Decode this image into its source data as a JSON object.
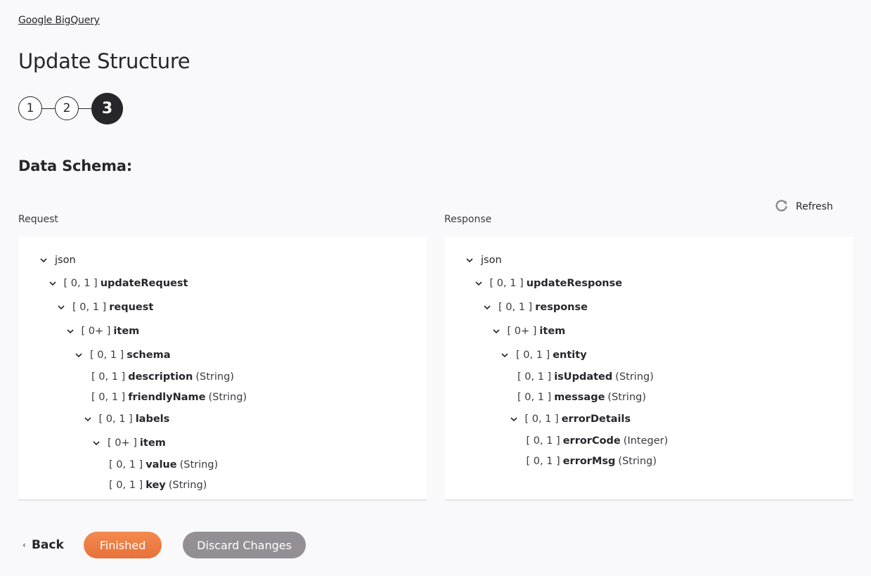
{
  "breadcrumb": "Google BigQuery",
  "title": "Update Structure",
  "stepper": {
    "steps": [
      "1",
      "2",
      "3"
    ],
    "active_step": 3
  },
  "section_title": "Data Schema:",
  "refresh_label": "Refresh",
  "request": {
    "label": "Request",
    "nodes": [
      {
        "depth": 0,
        "expandable": true,
        "card": "",
        "name": "json",
        "type": "",
        "bold": false
      },
      {
        "depth": 1,
        "expandable": true,
        "card": "[ 0, 1 ]",
        "name": "updateRequest",
        "type": ""
      },
      {
        "depth": 2,
        "expandable": true,
        "card": "[ 0, 1 ]",
        "name": "request",
        "type": ""
      },
      {
        "depth": 3,
        "expandable": true,
        "card": "[ 0+ ]",
        "name": "item",
        "type": ""
      },
      {
        "depth": 4,
        "expandable": true,
        "card": "[ 0, 1 ]",
        "name": "schema",
        "type": ""
      },
      {
        "depth": 5,
        "expandable": false,
        "card": "[ 0, 1 ]",
        "name": "description",
        "type": "(String)"
      },
      {
        "depth": 5,
        "expandable": false,
        "card": "[ 0, 1 ]",
        "name": "friendlyName",
        "type": "(String)"
      },
      {
        "depth": 5,
        "expandable": true,
        "card": "[ 0, 1 ]",
        "name": "labels",
        "type": ""
      },
      {
        "depth": 6,
        "expandable": true,
        "card": "[ 0+ ]",
        "name": "item",
        "type": ""
      },
      {
        "depth": 7,
        "expandable": false,
        "card": "[ 0, 1 ]",
        "name": "value",
        "type": "(String)"
      },
      {
        "depth": 7,
        "expandable": false,
        "card": "[ 0, 1 ]",
        "name": "key",
        "type": "(String)"
      }
    ]
  },
  "response": {
    "label": "Response",
    "nodes": [
      {
        "depth": 0,
        "expandable": true,
        "card": "",
        "name": "json",
        "type": "",
        "bold": false
      },
      {
        "depth": 1,
        "expandable": true,
        "card": "[ 0, 1 ]",
        "name": "updateResponse",
        "type": ""
      },
      {
        "depth": 2,
        "expandable": true,
        "card": "[ 0, 1 ]",
        "name": "response",
        "type": ""
      },
      {
        "depth": 3,
        "expandable": true,
        "card": "[ 0+ ]",
        "name": "item",
        "type": ""
      },
      {
        "depth": 4,
        "expandable": true,
        "card": "[ 0, 1 ]",
        "name": "entity",
        "type": ""
      },
      {
        "depth": 5,
        "expandable": false,
        "card": "[ 0, 1 ]",
        "name": "isUpdated",
        "type": "(String)"
      },
      {
        "depth": 5,
        "expandable": false,
        "card": "[ 0, 1 ]",
        "name": "message",
        "type": "(String)"
      },
      {
        "depth": 5,
        "expandable": true,
        "card": "[ 0, 1 ]",
        "name": "errorDetails",
        "type": ""
      },
      {
        "depth": 6,
        "expandable": false,
        "card": "[ 0, 1 ]",
        "name": "errorCode",
        "type": "(Integer)"
      },
      {
        "depth": 6,
        "expandable": false,
        "card": "[ 0, 1 ]",
        "name": "errorMsg",
        "type": "(String)"
      }
    ]
  },
  "footer": {
    "back_label": "Back",
    "finished_label": "Finished",
    "discard_label": "Discard Changes"
  },
  "colors": {
    "accent": "#ee7d44",
    "secondary_button": "#938f95",
    "text": "#26262b"
  }
}
